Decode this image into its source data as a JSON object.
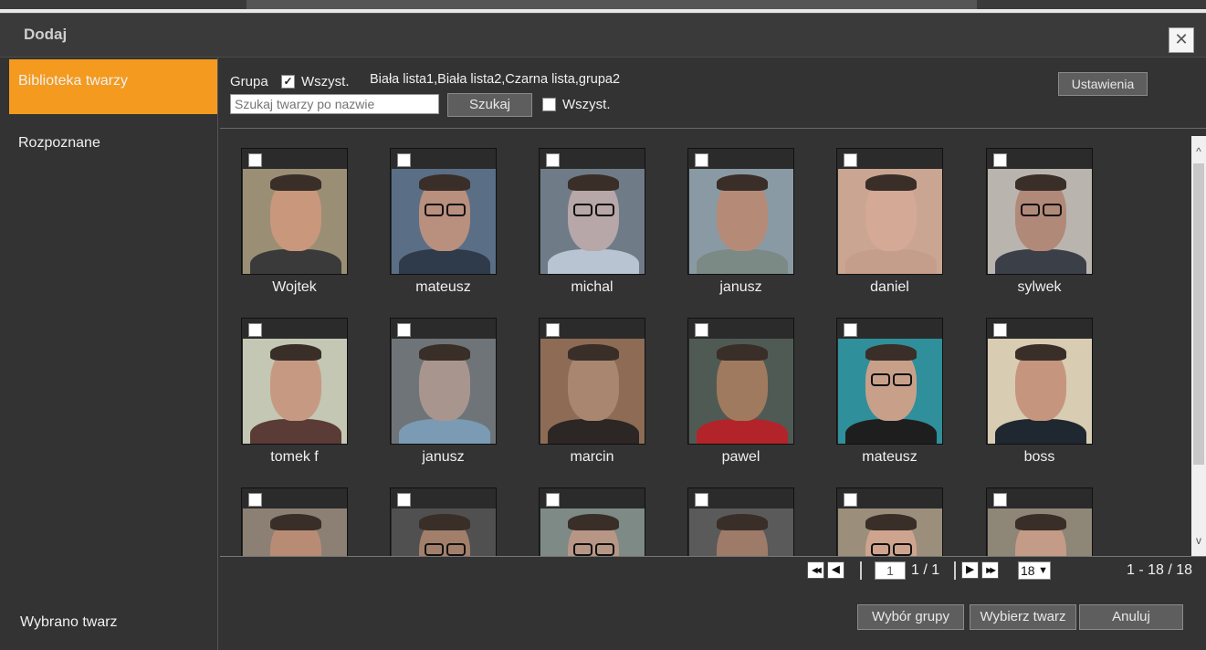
{
  "dialog": {
    "title": "Dodaj",
    "close_glyph": "✕"
  },
  "sidebar": {
    "items": [
      {
        "label": "Biblioteka twarzy"
      },
      {
        "label": "Rozpoznane"
      }
    ],
    "footer": "Wybrano twarz"
  },
  "toolbar": {
    "group_label": "Grupa",
    "group_all_label": "Wszyst.",
    "group_all_checked": true,
    "groups_list": "Biała lista1,Biała lista2,Czarna lista,grupa2",
    "settings_button": "Ustawienia",
    "search_placeholder": "Szukaj twarzy po nazwie",
    "search_value": "",
    "search_button": "Szukaj",
    "select_all_label": "Wszyst.",
    "select_all_checked": false
  },
  "faces": [
    {
      "name": "Wojtek",
      "bg": "#9a8f74",
      "skin": "#c9977c",
      "shirt": "#3a3a3a",
      "glasses": false
    },
    {
      "name": "mateusz",
      "bg": "#5a6e86",
      "skin": "#b98f7e",
      "shirt": "#2f3b4a",
      "glasses": true
    },
    {
      "name": "michal",
      "bg": "#6f7c88",
      "skin": "#b7a7a8",
      "shirt": "#b9c4d2",
      "glasses": true
    },
    {
      "name": "janusz",
      "bg": "#8a9aa4",
      "skin": "#b58b78",
      "shirt": "#7b8a84",
      "glasses": false
    },
    {
      "name": "daniel",
      "bg": "#caa592",
      "skin": "#d4a996",
      "shirt": "#c49e8a",
      "glasses": false
    },
    {
      "name": "sylwek",
      "bg": "#b9b4ae",
      "skin": "#b18979",
      "shirt": "#3b3f48",
      "glasses": true
    },
    {
      "name": "tomek f",
      "bg": "#c3c7b4",
      "skin": "#c69a82",
      "shirt": "#5a3b36",
      "glasses": false
    },
    {
      "name": "janusz",
      "bg": "#6f7478",
      "skin": "#a8968e",
      "shirt": "#7a9bb3",
      "glasses": false
    },
    {
      "name": "marcin",
      "bg": "#8d6b55",
      "skin": "#a98670",
      "shirt": "#2c2624",
      "glasses": false
    },
    {
      "name": "pawel",
      "bg": "#4f5a54",
      "skin": "#a07a5e",
      "shirt": "#b3242a",
      "glasses": false
    },
    {
      "name": "mateusz",
      "bg": "#2f8f9a",
      "skin": "#c8a08a",
      "shirt": "#1e1e1e",
      "glasses": true
    },
    {
      "name": "boss",
      "bg": "#d8ccb2",
      "skin": "#c5967d",
      "shirt": "#1f2730",
      "glasses": false
    },
    {
      "name": "",
      "bg": "#8c8074",
      "skin": "#b88c74",
      "shirt": "#3b3b3b",
      "glasses": false
    },
    {
      "name": "",
      "bg": "#505050",
      "skin": "#a27f6a",
      "shirt": "#2a2a2a",
      "glasses": true
    },
    {
      "name": "",
      "bg": "#7e8a86",
      "skin": "#b79686",
      "shirt": "#444",
      "glasses": true
    },
    {
      "name": "",
      "bg": "#5a5a5a",
      "skin": "#9e7b69",
      "shirt": "#2b2b2b",
      "glasses": false
    },
    {
      "name": "",
      "bg": "#9b8f7c",
      "skin": "#cfa48e",
      "shirt": "#444",
      "glasses": true
    },
    {
      "name": "",
      "bg": "#8e8778",
      "skin": "#c49b86",
      "shirt": "#444",
      "glasses": false
    }
  ],
  "pager": {
    "first_glyph": "◀◀",
    "prev_glyph": "◀",
    "next_glyph": "▶",
    "last_glyph": "▶▶",
    "page_input": "1",
    "page_of": "1 / 1",
    "per_page": "18",
    "range": "1 - 18 / 18"
  },
  "footer": {
    "select_group_button": "Wybór grupy",
    "select_face_button": "Wybierz twarz",
    "cancel_button": "Anuluj"
  }
}
